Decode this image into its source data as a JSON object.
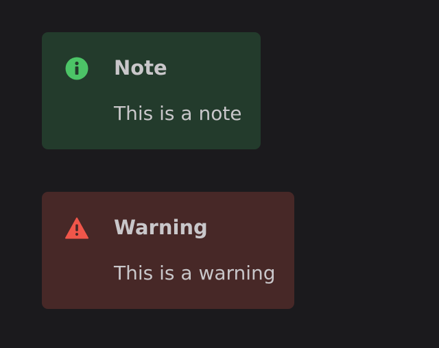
{
  "colors": {
    "page_background": "#1b1a1d",
    "note_background": "#233b2c",
    "note_accent": "#4cc467",
    "warning_background": "#472827",
    "warning_accent": "#f0564a",
    "text": "#c9c7ca"
  },
  "callouts": [
    {
      "type": "note",
      "icon": "info-circle-icon",
      "title": "Note",
      "body": "This is a note"
    },
    {
      "type": "warning",
      "icon": "warning-triangle-icon",
      "title": "Warning",
      "body": "This is a warning"
    }
  ]
}
